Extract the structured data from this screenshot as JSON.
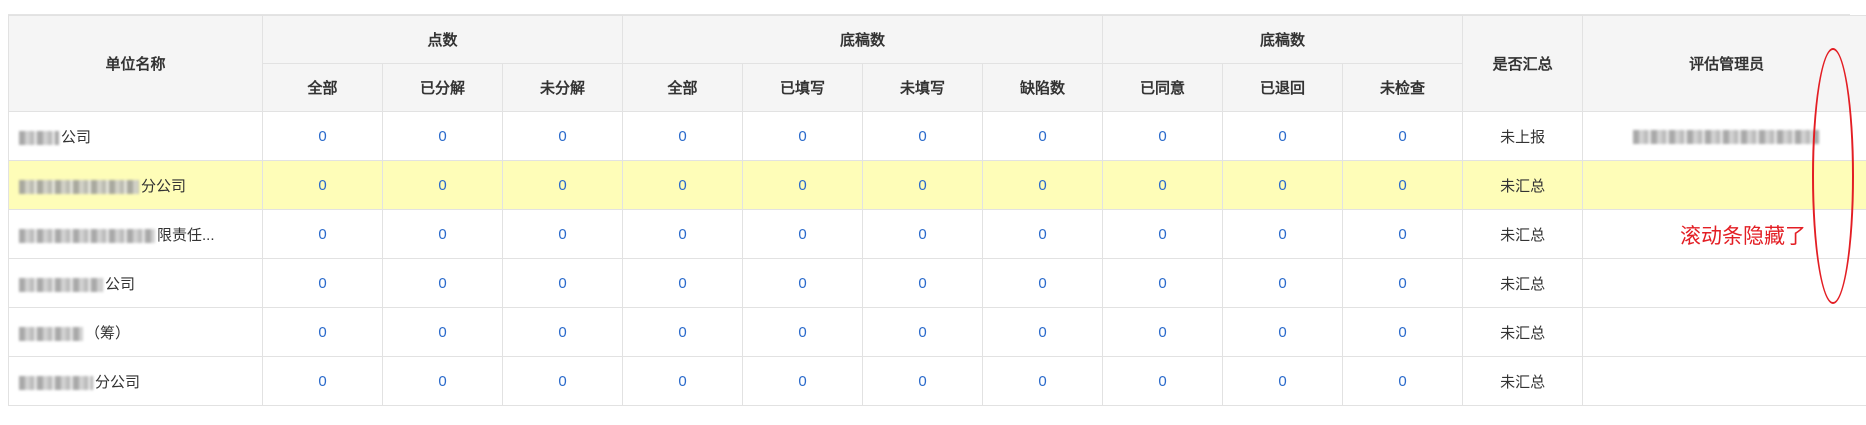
{
  "table": {
    "headers": {
      "unit_name": "单位名称",
      "group_points": "点数",
      "group_drafts_1": "底稿数",
      "group_drafts_2": "底稿数",
      "summarized": "是否汇总",
      "admin": "评估管理员",
      "sub": {
        "points_all": "全部",
        "points_decomposed": "已分解",
        "points_undecomposed": "未分解",
        "drafts_all": "全部",
        "drafts_filled": "已填写",
        "drafts_unfilled": "未填写",
        "drafts_defects": "缺陷数",
        "review_agreed": "已同意",
        "review_returned": "已退回",
        "review_unchecked": "未检查"
      }
    },
    "rows": [
      {
        "unit_suffix": "公司",
        "values": [
          "0",
          "0",
          "0",
          "0",
          "0",
          "0",
          "0",
          "0",
          "0",
          "0"
        ],
        "status": "未上报",
        "admin_blurred": true
      },
      {
        "unit_suffix": "分公司",
        "values": [
          "0",
          "0",
          "0",
          "0",
          "0",
          "0",
          "0",
          "0",
          "0",
          "0"
        ],
        "status": "未汇总",
        "admin_blurred": false
      },
      {
        "unit_suffix": "限责任...",
        "values": [
          "0",
          "0",
          "0",
          "0",
          "0",
          "0",
          "0",
          "0",
          "0",
          "0"
        ],
        "status": "未汇总",
        "admin_blurred": false
      },
      {
        "unit_suffix": "公司",
        "values": [
          "0",
          "0",
          "0",
          "0",
          "0",
          "0",
          "0",
          "0",
          "0",
          "0"
        ],
        "status": "未汇总",
        "admin_blurred": false
      },
      {
        "unit_suffix": "（筹）",
        "values": [
          "0",
          "0",
          "0",
          "0",
          "0",
          "0",
          "0",
          "0",
          "0",
          "0"
        ],
        "status": "未汇总",
        "admin_blurred": false
      },
      {
        "unit_suffix": "分公司",
        "values": [
          "0",
          "0",
          "0",
          "0",
          "0",
          "0",
          "0",
          "0",
          "0",
          "0"
        ],
        "status": "未汇总",
        "admin_blurred": false
      }
    ]
  },
  "annotation": {
    "text": "滚动条隐藏了",
    "color": "#e31e24"
  },
  "colors": {
    "header_bg": "#f5f5f5",
    "highlight_row": "#fefdb8",
    "number_link": "#2a6acb",
    "border": "#e2e2e2"
  }
}
